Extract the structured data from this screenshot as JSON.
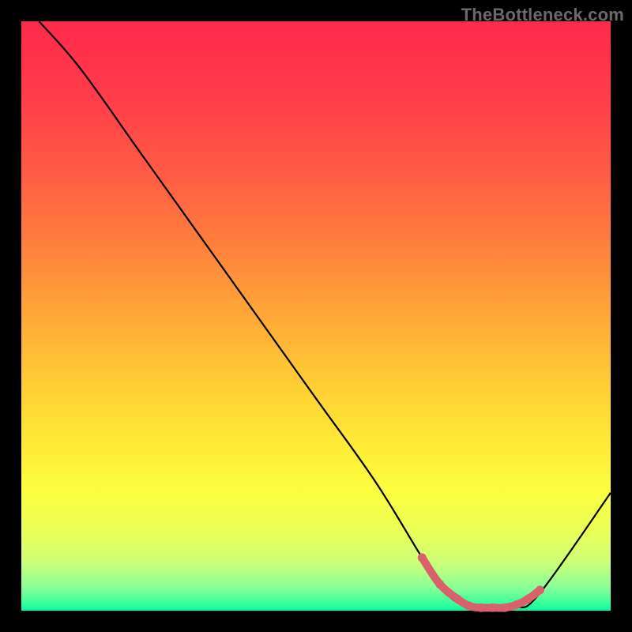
{
  "attribution": "TheBottleneck.com",
  "chart_data": {
    "type": "line",
    "title": "",
    "xlabel": "",
    "ylabel": "",
    "xlim": [
      0,
      100
    ],
    "ylim": [
      0,
      100
    ],
    "series": [
      {
        "name": "main-curve",
        "x": [
          3,
          10,
          20,
          30,
          40,
          50,
          60,
          68,
          72,
          76,
          80,
          84,
          88,
          100
        ],
        "y": [
          100,
          92,
          78,
          64,
          50,
          36,
          22,
          9,
          3,
          0.5,
          0.5,
          0.5,
          3,
          20
        ]
      },
      {
        "name": "highlight-segment",
        "x": [
          68,
          71,
          74,
          76,
          78,
          80,
          82,
          84,
          86,
          88
        ],
        "y": [
          9,
          4.5,
          2,
          0.8,
          0.5,
          0.5,
          0.5,
          1,
          2,
          3.5
        ]
      }
    ],
    "colors": {
      "curve": "#000000",
      "highlight": "#d9616b"
    }
  }
}
